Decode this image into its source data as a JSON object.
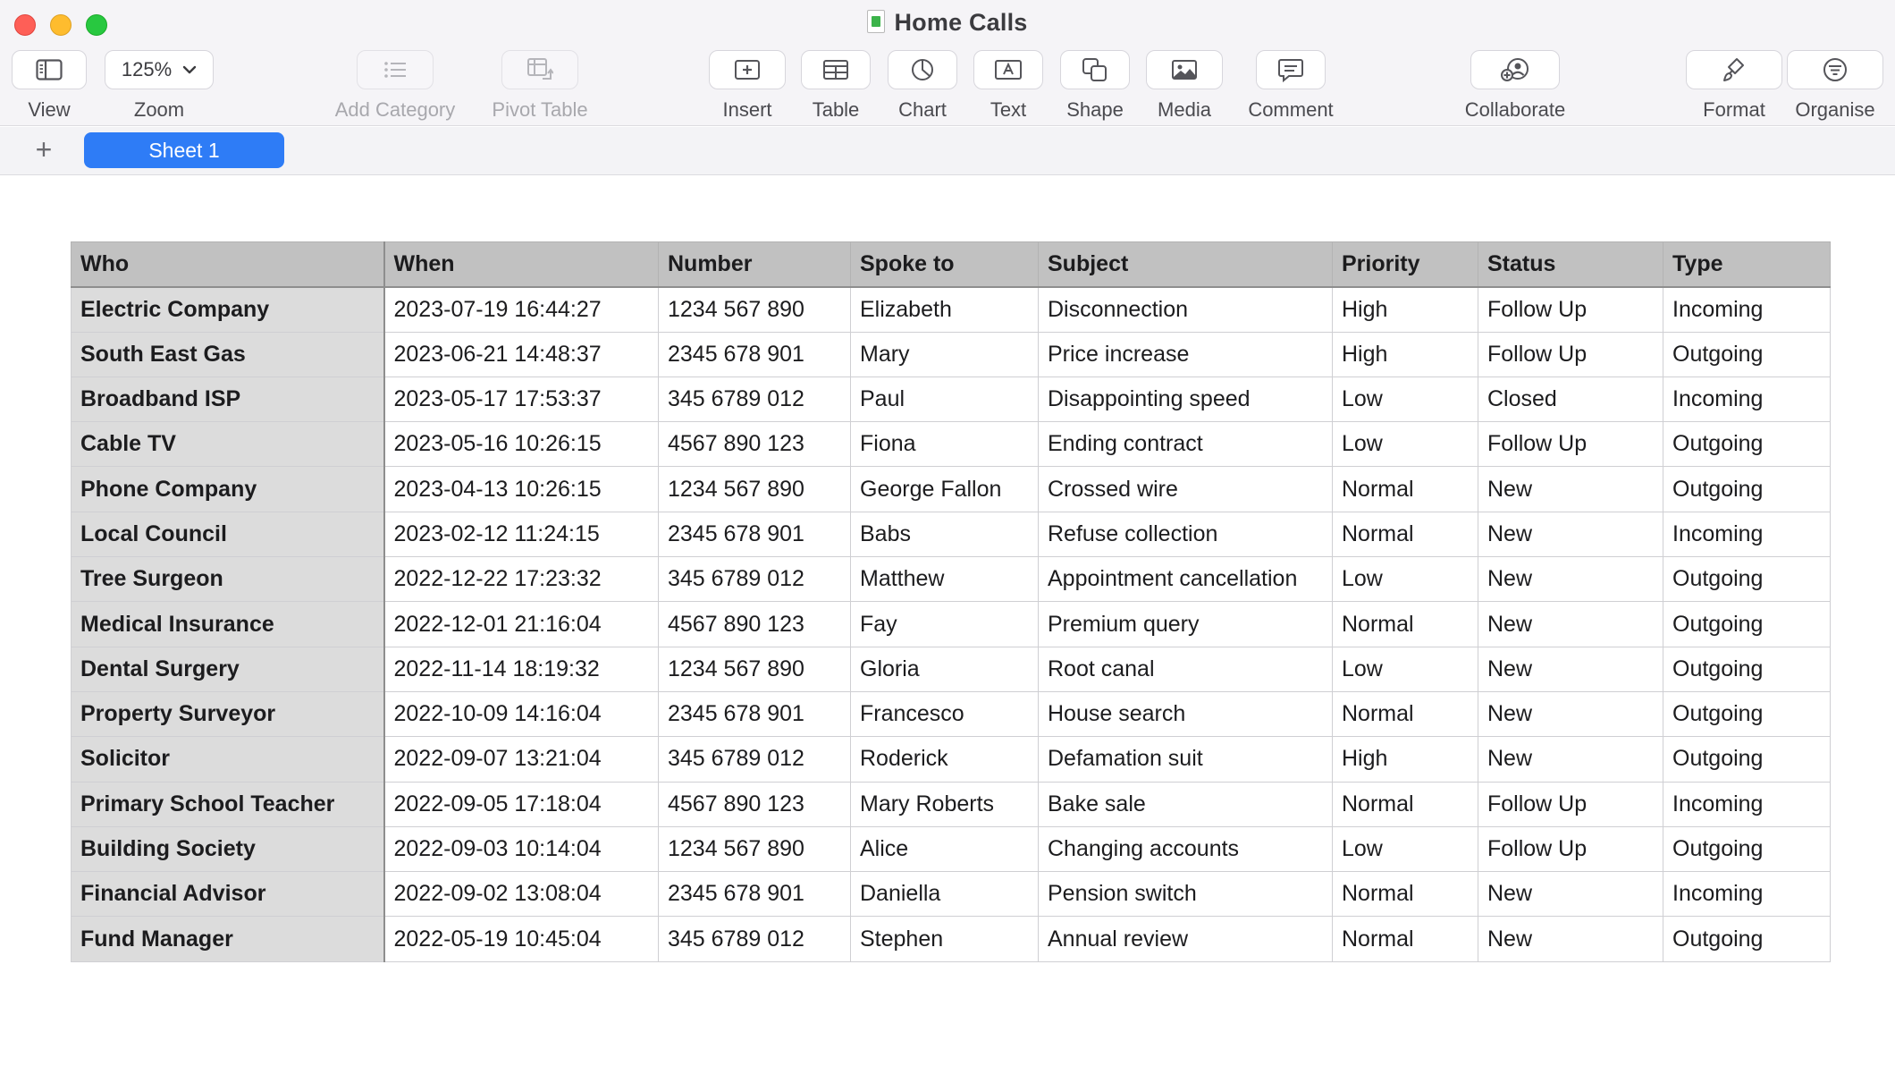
{
  "window": {
    "title": "Home Calls"
  },
  "toolbar": {
    "view_label": "View",
    "zoom_label": "Zoom",
    "zoom_value": "125%",
    "add_category_label": "Add Category",
    "pivot_table_label": "Pivot Table",
    "insert_label": "Insert",
    "table_label": "Table",
    "chart_label": "Chart",
    "text_label": "Text",
    "shape_label": "Shape",
    "media_label": "Media",
    "comment_label": "Comment",
    "collaborate_label": "Collaborate",
    "format_label": "Format",
    "organise_label": "Organise"
  },
  "sheets": {
    "add_label": "+",
    "active": "Sheet 1"
  },
  "table": {
    "columns": [
      "Who",
      "When",
      "Number",
      "Spoke to",
      "Subject",
      "Priority",
      "Status",
      "Type"
    ],
    "rows": [
      [
        "Electric Company",
        "2023-07-19 16:44:27",
        "1234 567 890",
        "Elizabeth",
        "Disconnection",
        "High",
        "Follow Up",
        "Incoming"
      ],
      [
        "South East Gas",
        "2023-06-21 14:48:37",
        "2345 678 901",
        "Mary",
        "Price increase",
        "High",
        "Follow Up",
        "Outgoing"
      ],
      [
        "Broadband ISP",
        "2023-05-17 17:53:37",
        "345 6789 012",
        "Paul",
        "Disappointing speed",
        "Low",
        "Closed",
        "Incoming"
      ],
      [
        "Cable TV",
        "2023-05-16 10:26:15",
        "4567 890 123",
        "Fiona",
        "Ending contract",
        "Low",
        "Follow Up",
        "Outgoing"
      ],
      [
        "Phone Company",
        "2023-04-13 10:26:15",
        "1234 567 890",
        "George Fallon",
        "Crossed wire",
        "Normal",
        "New",
        "Outgoing"
      ],
      [
        "Local Council",
        "2023-02-12 11:24:15",
        "2345 678 901",
        "Babs",
        "Refuse collection",
        "Normal",
        "New",
        "Incoming"
      ],
      [
        "Tree Surgeon",
        "2022-12-22 17:23:32",
        "345 6789 012",
        "Matthew",
        "Appointment cancellation",
        "Low",
        "New",
        "Outgoing"
      ],
      [
        "Medical Insurance",
        "2022-12-01 21:16:04",
        "4567 890 123",
        "Fay",
        "Premium query",
        "Normal",
        "New",
        "Outgoing"
      ],
      [
        "Dental Surgery",
        "2022-11-14 18:19:32",
        "1234 567 890",
        "Gloria",
        "Root canal",
        "Low",
        "New",
        "Outgoing"
      ],
      [
        "Property Surveyor",
        "2022-10-09 14:16:04",
        "2345 678 901",
        "Francesco",
        "House search",
        "Normal",
        "New",
        "Outgoing"
      ],
      [
        "Solicitor",
        "2022-09-07 13:21:04",
        "345 6789 012",
        "Roderick",
        "Defamation suit",
        "High",
        "New",
        "Outgoing"
      ],
      [
        "Primary School Teacher",
        "2022-09-05 17:18:04",
        "4567 890 123",
        "Mary Roberts",
        "Bake sale",
        "Normal",
        "Follow Up",
        "Incoming"
      ],
      [
        "Building Society",
        "2022-09-03 10:14:04",
        "1234 567 890",
        "Alice",
        "Changing accounts",
        "Low",
        "Follow Up",
        "Outgoing"
      ],
      [
        "Financial Advisor",
        "2022-09-02 13:08:04",
        "2345 678 901",
        "Daniella",
        "Pension switch",
        "Normal",
        "New",
        "Incoming"
      ],
      [
        "Fund Manager",
        "2022-05-19 10:45:04",
        "345 6789 012",
        "Stephen",
        "Annual review",
        "Normal",
        "New",
        "Outgoing"
      ]
    ]
  }
}
